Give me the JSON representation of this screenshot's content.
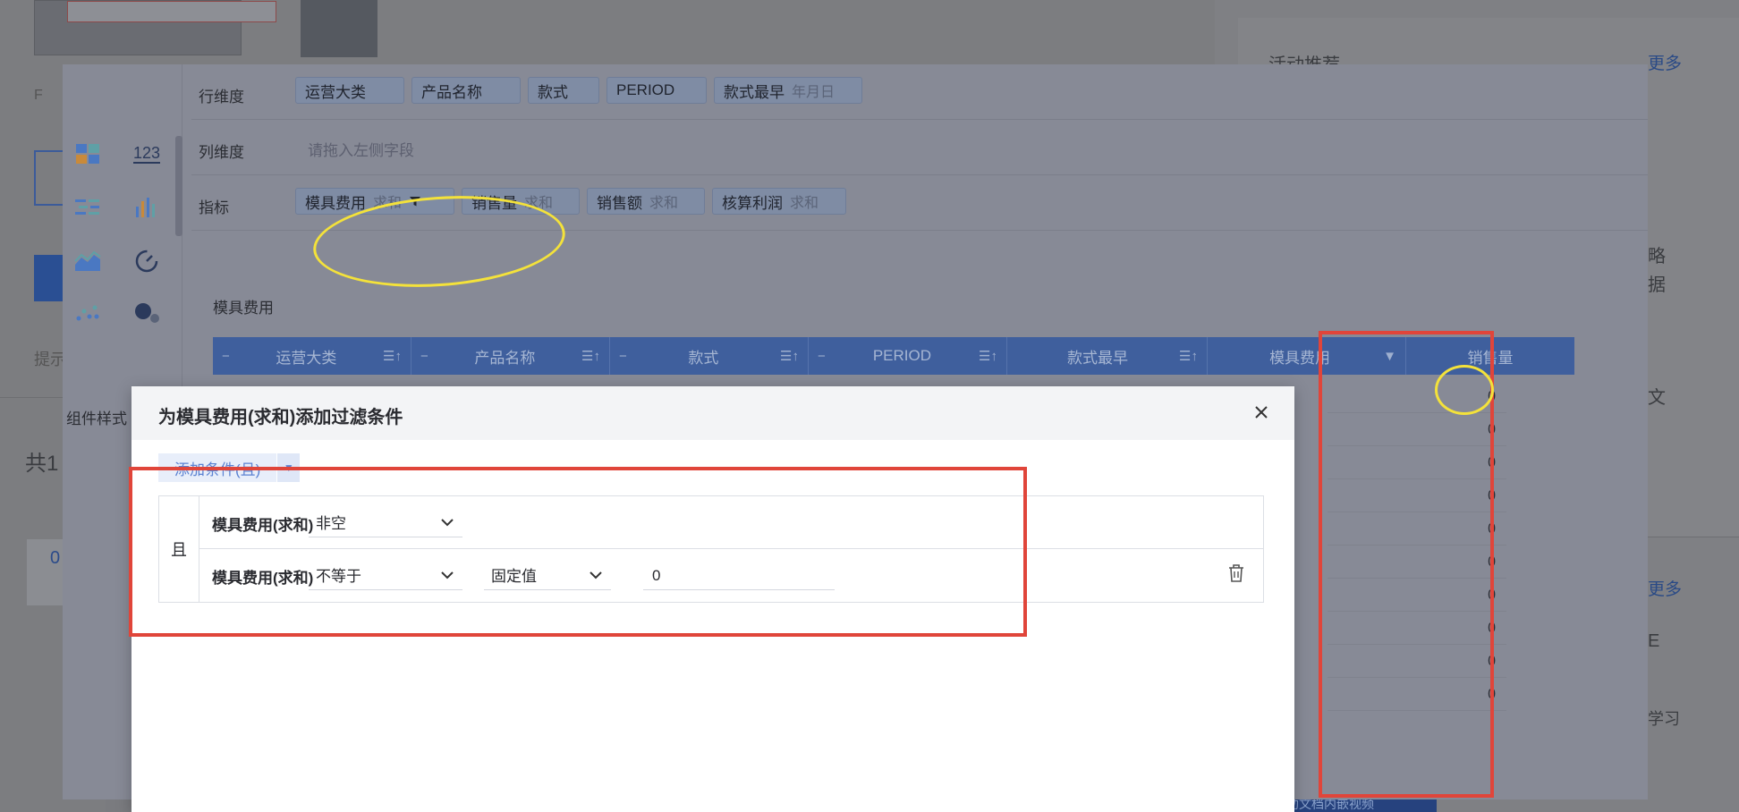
{
  "background": {
    "section_title": "活动推荐",
    "more_top": "更多",
    "more_bottom": "更多",
    "count_label": "共1",
    "hint_label": "提示",
    "tag_label": "F",
    "like_count": "0",
    "right_fragments": [
      "略",
      "据",
      "文",
      "E",
      "学习"
    ],
    "help_video": "帮助文档内嵌视频"
  },
  "editor": {
    "toolbar_icons": [
      "dashboard-icon",
      "number-123-icon",
      "table-tree-icon",
      "bar-chart-icon",
      "area-chart-icon",
      "gauge-icon",
      "scatter-icon",
      "bubble-icon"
    ],
    "tool_label_123": "123",
    "component_style": "组件样式",
    "row_dim": {
      "label": "行维度",
      "chips": [
        {
          "name": "运营大类",
          "sub": ""
        },
        {
          "name": "产品名称",
          "sub": ""
        },
        {
          "name": "款式",
          "sub": ""
        },
        {
          "name": "PERIOD",
          "sub": ""
        },
        {
          "name": "款式最早",
          "sub": "年月日"
        }
      ]
    },
    "col_dim": {
      "label": "列维度",
      "placeholder": "请拖入左侧字段"
    },
    "metrics": {
      "label": "指标",
      "chips": [
        {
          "name": "模具费用",
          "sub": "求和",
          "filter": true
        },
        {
          "name": "销售量",
          "sub": "求和",
          "filter": false
        },
        {
          "name": "销售额",
          "sub": "求和",
          "filter": false
        },
        {
          "name": "核算利润",
          "sub": "求和",
          "filter": false
        }
      ]
    },
    "preview_title": "模具费用",
    "table": {
      "columns": [
        {
          "name": "运营大类",
          "sort_icon": "sort-icon"
        },
        {
          "name": "产品名称",
          "sort_icon": "sort-icon"
        },
        {
          "name": "款式",
          "sort_icon": "sort-icon"
        },
        {
          "name": "PERIOD",
          "sort_icon": "sort-icon"
        },
        {
          "name": "款式最早",
          "sort_icon": "sort-icon"
        },
        {
          "name": "模具费用",
          "sort_icon": "filter-icon"
        },
        {
          "name": "销售量",
          "sort_icon": ""
        }
      ],
      "mold_cost_values": [
        "0",
        "0",
        "0",
        "0",
        "0",
        "0",
        "0",
        "0",
        "0",
        "0"
      ]
    }
  },
  "dialog": {
    "title": "为模具费用(求和)添加过滤条件",
    "add_condition": "添加条件(且)",
    "logic": "且",
    "conditions": [
      {
        "field": "模具费用(求和)",
        "operator": "非空"
      },
      {
        "field": "模具费用(求和)",
        "operator": "不等于",
        "value_type": "固定值",
        "value": "0"
      }
    ]
  },
  "colors": {
    "header_blue": "#3f5f9d",
    "annotation_red": "#e0453a",
    "annotation_yellow": "#f4e23a",
    "link_blue": "#5b82d2"
  }
}
